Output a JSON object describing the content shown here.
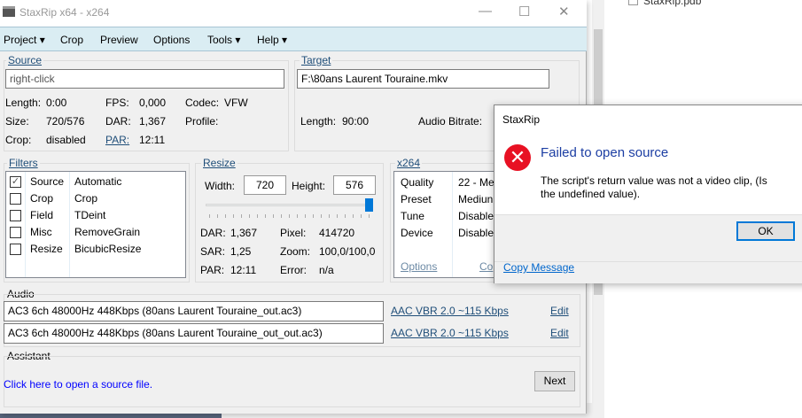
{
  "background": {
    "file_label": "StaxRip.pdb"
  },
  "window": {
    "title": "StaxRip x64 - x264",
    "controls": [
      "—",
      "☐",
      "✕"
    ]
  },
  "menu": [
    {
      "label": "Project",
      "dropdown": true
    },
    {
      "label": "Crop",
      "dropdown": false
    },
    {
      "label": "Preview",
      "dropdown": false
    },
    {
      "label": "Options",
      "dropdown": false
    },
    {
      "label": "Tools",
      "dropdown": true
    },
    {
      "label": "Help",
      "dropdown": true
    }
  ],
  "source": {
    "label": "Source",
    "value": "right-click",
    "length_label": "Length:",
    "length": "0:00",
    "fps_label": "FPS:",
    "fps": "0,000",
    "codec_label": "Codec:",
    "codec": "VFW",
    "size_label": "Size:",
    "size": "720/576",
    "dar_label": "DAR:",
    "dar": "1,367",
    "profile_label": "Profile:",
    "crop_label": "Crop:",
    "crop": "disabled",
    "par_label": "PAR:",
    "par": "12:11"
  },
  "target": {
    "label": "Target",
    "value": "F:\\80ans Laurent Touraine.mkv",
    "length_label": "Length:",
    "length": "90:00",
    "audio_bitrate_label": "Audio Bitrate:"
  },
  "filters": {
    "label": "Filters",
    "items": [
      {
        "name": "Source",
        "value": "Automatic",
        "checked": true
      },
      {
        "name": "Crop",
        "value": "Crop",
        "checked": false
      },
      {
        "name": "Field",
        "value": "TDeint",
        "checked": false
      },
      {
        "name": "Misc",
        "value": "RemoveGrain",
        "checked": false
      },
      {
        "name": "Resize",
        "value": "BicubicResize",
        "checked": false
      }
    ]
  },
  "resize": {
    "label": "Resize",
    "width_label": "Width:",
    "width": "720",
    "height_label": "Height:",
    "height": "576",
    "slider_level": 1.0,
    "dar_label": "DAR:",
    "dar": "1,367",
    "sar_label": "SAR:",
    "sar": "1,25",
    "par_label": "PAR:",
    "par": "12:11",
    "pixel_label": "Pixel:",
    "pixel": "414720",
    "zoom_label": "Zoom:",
    "zoom": "100,0/100,0",
    "error_label": "Error:",
    "error": "n/a"
  },
  "x264": {
    "label": "x264",
    "rows": [
      {
        "k": "Quality",
        "v": "22 - Me"
      },
      {
        "k": "Preset",
        "v": "Mediun"
      },
      {
        "k": "Tune",
        "v": "Disable"
      },
      {
        "k": "Device",
        "v": "Disable"
      }
    ],
    "options_label": "Options",
    "co_label": "Co"
  },
  "audio": {
    "label": "Audio",
    "tracks": [
      {
        "file": "AC3 6ch 48000Hz 448Kbps (80ans Laurent Touraine_out.ac3)",
        "profile": "AAC VBR 2.0 ~115 Kbps",
        "edit": "Edit"
      },
      {
        "file": "AC3 6ch 48000Hz 448Kbps (80ans Laurent Touraine_out_out.ac3)",
        "profile": "AAC VBR 2.0 ~115 Kbps",
        "edit": "Edit"
      }
    ]
  },
  "assistant": {
    "label": "Assistant",
    "message": "Click here to open a source file.",
    "next_label": "Next"
  },
  "dialog": {
    "title": "StaxRip",
    "heading": "Failed to open source",
    "message": "The script's return value was not a video clip, (Is the undefined value).",
    "ok_label": "OK",
    "copy_label": "Copy Message",
    "error_color": "#e81123",
    "accent": "#0078d7"
  }
}
